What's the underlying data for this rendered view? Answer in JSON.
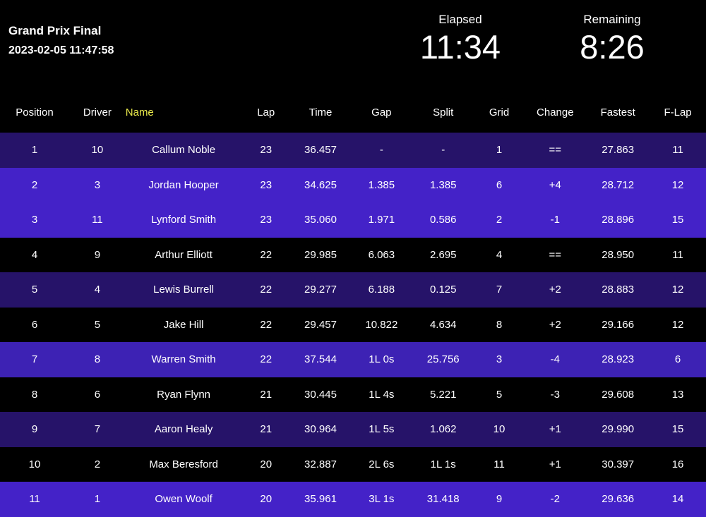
{
  "header": {
    "event_title": "Grand Prix Final",
    "event_datetime": "2023-02-05 11:47:58",
    "elapsed_label": "Elapsed",
    "elapsed_value": "11:34",
    "remaining_label": "Remaining",
    "remaining_value": "8:26"
  },
  "colors": {
    "background": "#000000",
    "row_dark": "#261369",
    "row_bright": "#4422c8",
    "row_mid": "#3d22b4",
    "accent_name": "#e8e84a",
    "accent_gain": "#2ee82e",
    "accent_loss": "#e8184a",
    "text": "#ffffff"
  },
  "table": {
    "columns": [
      {
        "key": "position",
        "label": "Position"
      },
      {
        "key": "driver",
        "label": "Driver"
      },
      {
        "key": "name",
        "label": "Name"
      },
      {
        "key": "lap",
        "label": "Lap"
      },
      {
        "key": "time",
        "label": "Time"
      },
      {
        "key": "gap",
        "label": "Gap"
      },
      {
        "key": "split",
        "label": "Split"
      },
      {
        "key": "grid",
        "label": "Grid"
      },
      {
        "key": "change",
        "label": "Change"
      },
      {
        "key": "fastest",
        "label": "Fastest"
      },
      {
        "key": "flap",
        "label": "F-Lap"
      }
    ],
    "rows": [
      {
        "position": "1",
        "driver": "10",
        "name": "Callum Noble",
        "lap": "23",
        "time": "36.457",
        "gap": "-",
        "split": "-",
        "grid": "1",
        "change": "==",
        "change_dir": "same",
        "fastest": "27.863",
        "flap": "11",
        "fastest_highlight": true,
        "bg": "dark"
      },
      {
        "position": "2",
        "driver": "3",
        "name": "Jordan Hooper",
        "lap": "23",
        "time": "34.625",
        "gap": "1.385",
        "split": "1.385",
        "grid": "6",
        "change": "+4",
        "change_dir": "up",
        "fastest": "28.712",
        "flap": "12",
        "fastest_highlight": false,
        "bg": "bright"
      },
      {
        "position": "3",
        "driver": "11",
        "name": "Lynford Smith",
        "lap": "23",
        "time": "35.060",
        "gap": "1.971",
        "split": "0.586",
        "grid": "2",
        "change": "-1",
        "change_dir": "down",
        "fastest": "28.896",
        "flap": "15",
        "fastest_highlight": false,
        "bg": "bright"
      },
      {
        "position": "4",
        "driver": "9",
        "name": "Arthur Elliott",
        "lap": "22",
        "time": "29.985",
        "gap": "6.063",
        "split": "2.695",
        "grid": "4",
        "change": "==",
        "change_dir": "same",
        "fastest": "28.950",
        "flap": "11",
        "fastest_highlight": false,
        "bg": "black"
      },
      {
        "position": "5",
        "driver": "4",
        "name": "Lewis Burrell",
        "lap": "22",
        "time": "29.277",
        "gap": "6.188",
        "split": "0.125",
        "grid": "7",
        "change": "+2",
        "change_dir": "up",
        "fastest": "28.883",
        "flap": "12",
        "fastest_highlight": false,
        "bg": "dark"
      },
      {
        "position": "6",
        "driver": "5",
        "name": "Jake Hill",
        "lap": "22",
        "time": "29.457",
        "gap": "10.822",
        "split": "4.634",
        "grid": "8",
        "change": "+2",
        "change_dir": "up",
        "fastest": "29.166",
        "flap": "12",
        "fastest_highlight": false,
        "bg": "black"
      },
      {
        "position": "7",
        "driver": "8",
        "name": "Warren Smith",
        "lap": "22",
        "time": "37.544",
        "gap": "1L 0s",
        "split": "25.756",
        "grid": "3",
        "change": "-4",
        "change_dir": "down",
        "fastest": "28.923",
        "flap": "6",
        "fastest_highlight": false,
        "bg": "mid"
      },
      {
        "position": "8",
        "driver": "6",
        "name": "Ryan Flynn",
        "lap": "21",
        "time": "30.445",
        "gap": "1L 4s",
        "split": "5.221",
        "grid": "5",
        "change": "-3",
        "change_dir": "down",
        "fastest": "29.608",
        "flap": "13",
        "fastest_highlight": false,
        "bg": "black"
      },
      {
        "position": "9",
        "driver": "7",
        "name": "Aaron Healy",
        "lap": "21",
        "time": "30.964",
        "gap": "1L 5s",
        "split": "1.062",
        "grid": "10",
        "change": "+1",
        "change_dir": "up",
        "fastest": "29.990",
        "flap": "15",
        "fastest_highlight": false,
        "bg": "dark"
      },
      {
        "position": "10",
        "driver": "2",
        "name": "Max Beresford",
        "lap": "20",
        "time": "32.887",
        "gap": "2L 6s",
        "split": "1L 1s",
        "grid": "11",
        "change": "+1",
        "change_dir": "up",
        "fastest": "30.397",
        "flap": "16",
        "fastest_highlight": false,
        "bg": "black"
      },
      {
        "position": "11",
        "driver": "1",
        "name": "Owen Woolf",
        "lap": "20",
        "time": "35.961",
        "gap": "3L 1s",
        "split": "31.418",
        "grid": "9",
        "change": "-2",
        "change_dir": "down",
        "fastest": "29.636",
        "flap": "14",
        "fastest_highlight": false,
        "bg": "bright"
      }
    ]
  }
}
